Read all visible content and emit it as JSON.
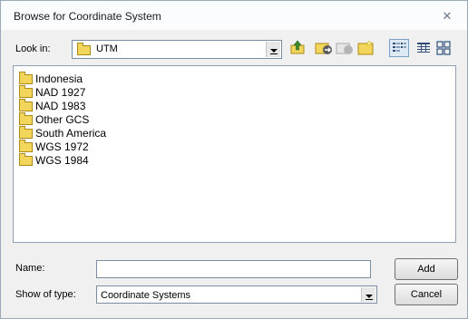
{
  "window": {
    "title": "Browse for Coordinate System",
    "close_glyph": "✕"
  },
  "toolbar": {
    "look_in_label": "Look in:",
    "look_in_value": "UTM",
    "icons": [
      "up-one-level-icon",
      "connect-folder-icon",
      "disconnect-folder-icon",
      "new-folder-icon",
      "list-view-icon",
      "details-view-icon",
      "thumbnails-view-icon"
    ]
  },
  "file_list": {
    "items": [
      {
        "label": "Indonesia",
        "icon": "folder-icon"
      },
      {
        "label": "NAD 1927",
        "icon": "folder-icon"
      },
      {
        "label": "NAD 1983",
        "icon": "folder-icon"
      },
      {
        "label": "Other GCS",
        "icon": "folder-icon"
      },
      {
        "label": "South America",
        "icon": "folder-icon"
      },
      {
        "label": "WGS 1972",
        "icon": "folder-icon"
      },
      {
        "label": "WGS 1984",
        "icon": "folder-icon"
      }
    ]
  },
  "footer": {
    "name_label": "Name:",
    "name_value": "",
    "type_label": "Show of type:",
    "type_value": "Coordinate Systems",
    "add_label": "Add",
    "cancel_label": "Cancel"
  },
  "colors": {
    "folder_fill": "#f2d55b",
    "dialog_bg": "#f0f0f0"
  }
}
